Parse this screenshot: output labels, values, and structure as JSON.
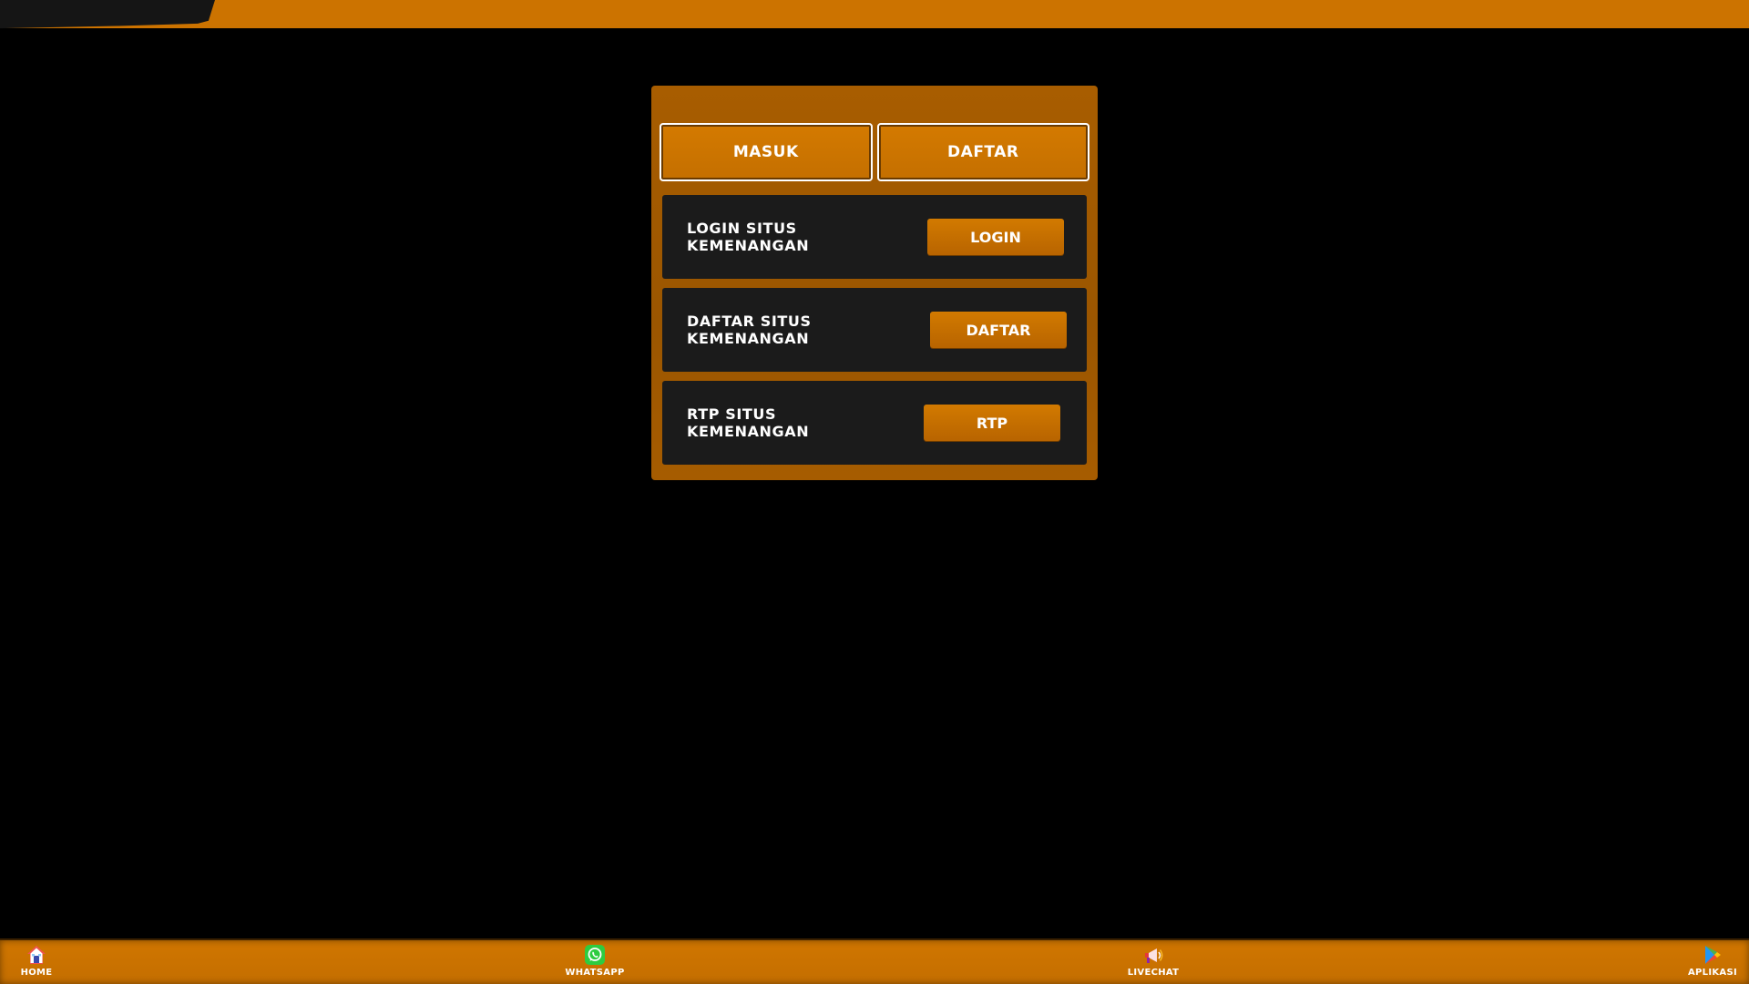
{
  "colors": {
    "accent": "#cc7300",
    "panel": "#a05a00",
    "card": "#1b1b1b",
    "background": "#000000"
  },
  "tabs": {
    "masuk_label": "MASUK",
    "daftar_label": "DAFTAR"
  },
  "cards": [
    {
      "title": "LOGIN SITUS KEMENANGAN",
      "button_label": "LOGIN"
    },
    {
      "title": "DAFTAR SITUS KEMENANGAN",
      "button_label": "DAFTAR"
    },
    {
      "title": "RTP SITUS KEMENANGAN",
      "button_label": "RTP"
    }
  ],
  "bottom_nav": {
    "items": [
      {
        "label": "HOME",
        "icon": "home-icon"
      },
      {
        "label": "WHATSAPP",
        "icon": "whatsapp-icon"
      },
      {
        "label": "LIVECHAT",
        "icon": "megaphone-icon"
      },
      {
        "label": "APLIKASI",
        "icon": "play-store-icon"
      }
    ]
  }
}
